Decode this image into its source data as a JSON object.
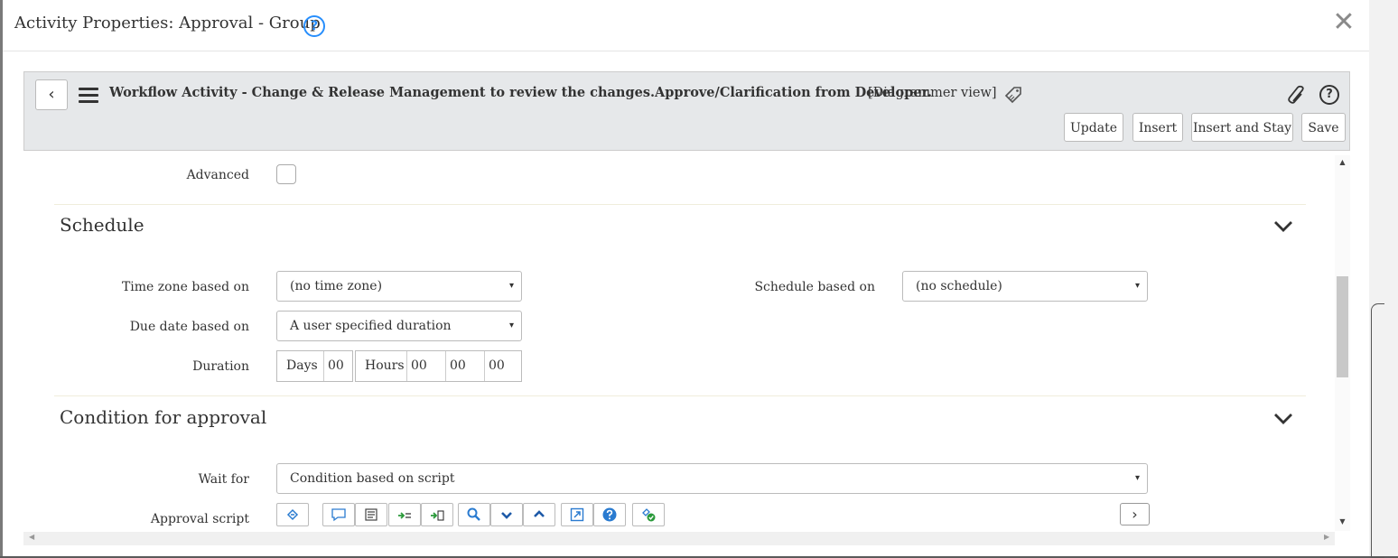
{
  "modal": {
    "title": "Activity Properties: Approval - Group",
    "help_glyph": "?",
    "close_glyph": "✕"
  },
  "form_header": {
    "back_glyph": "‹",
    "title": "Workflow Activity - Change & Release Management to review the changes.Approve/Clarification from Developer.",
    "view_label": "[Diagrammer view]",
    "help_glyph": "?",
    "buttons": {
      "update": "Update",
      "insert": "Insert",
      "insert_and_stay": "Insert and Stay",
      "save": "Save"
    }
  },
  "fields": {
    "advanced_label": "Advanced",
    "advanced_checked": false
  },
  "schedule": {
    "title": "Schedule",
    "time_zone_label": "Time zone based on",
    "time_zone_value": "(no time zone)",
    "schedule_label": "Schedule based on",
    "schedule_value": "(no schedule)",
    "due_date_label": "Due date based on",
    "due_date_value": "A user specified duration",
    "duration_label": "Duration",
    "days_label": "Days",
    "days_value": "00",
    "hours_label": "Hours",
    "hours_value": "00",
    "minutes_value": "00",
    "seconds_value": "00"
  },
  "condition": {
    "title": "Condition for approval",
    "wait_for_label": "Wait for",
    "wait_for_value": "Condition based on script",
    "approval_script_label": "Approval script",
    "next_glyph": "›"
  },
  "icons": {
    "select_arrow": "▾",
    "chevron": "chevron-down-icon",
    "toolbar": [
      "format-code-icon",
      "comment-icon",
      "document-icon",
      "replace-icon",
      "replace-all-icon",
      "search-icon",
      "collapse-down-icon",
      "expand-up-icon",
      "fullscreen-icon",
      "help-icon",
      "syntax-check-icon"
    ]
  },
  "colors": {
    "accent_blue": "#278efc",
    "header_bg": "#e6e8ea",
    "divider": "#f0eddc"
  }
}
